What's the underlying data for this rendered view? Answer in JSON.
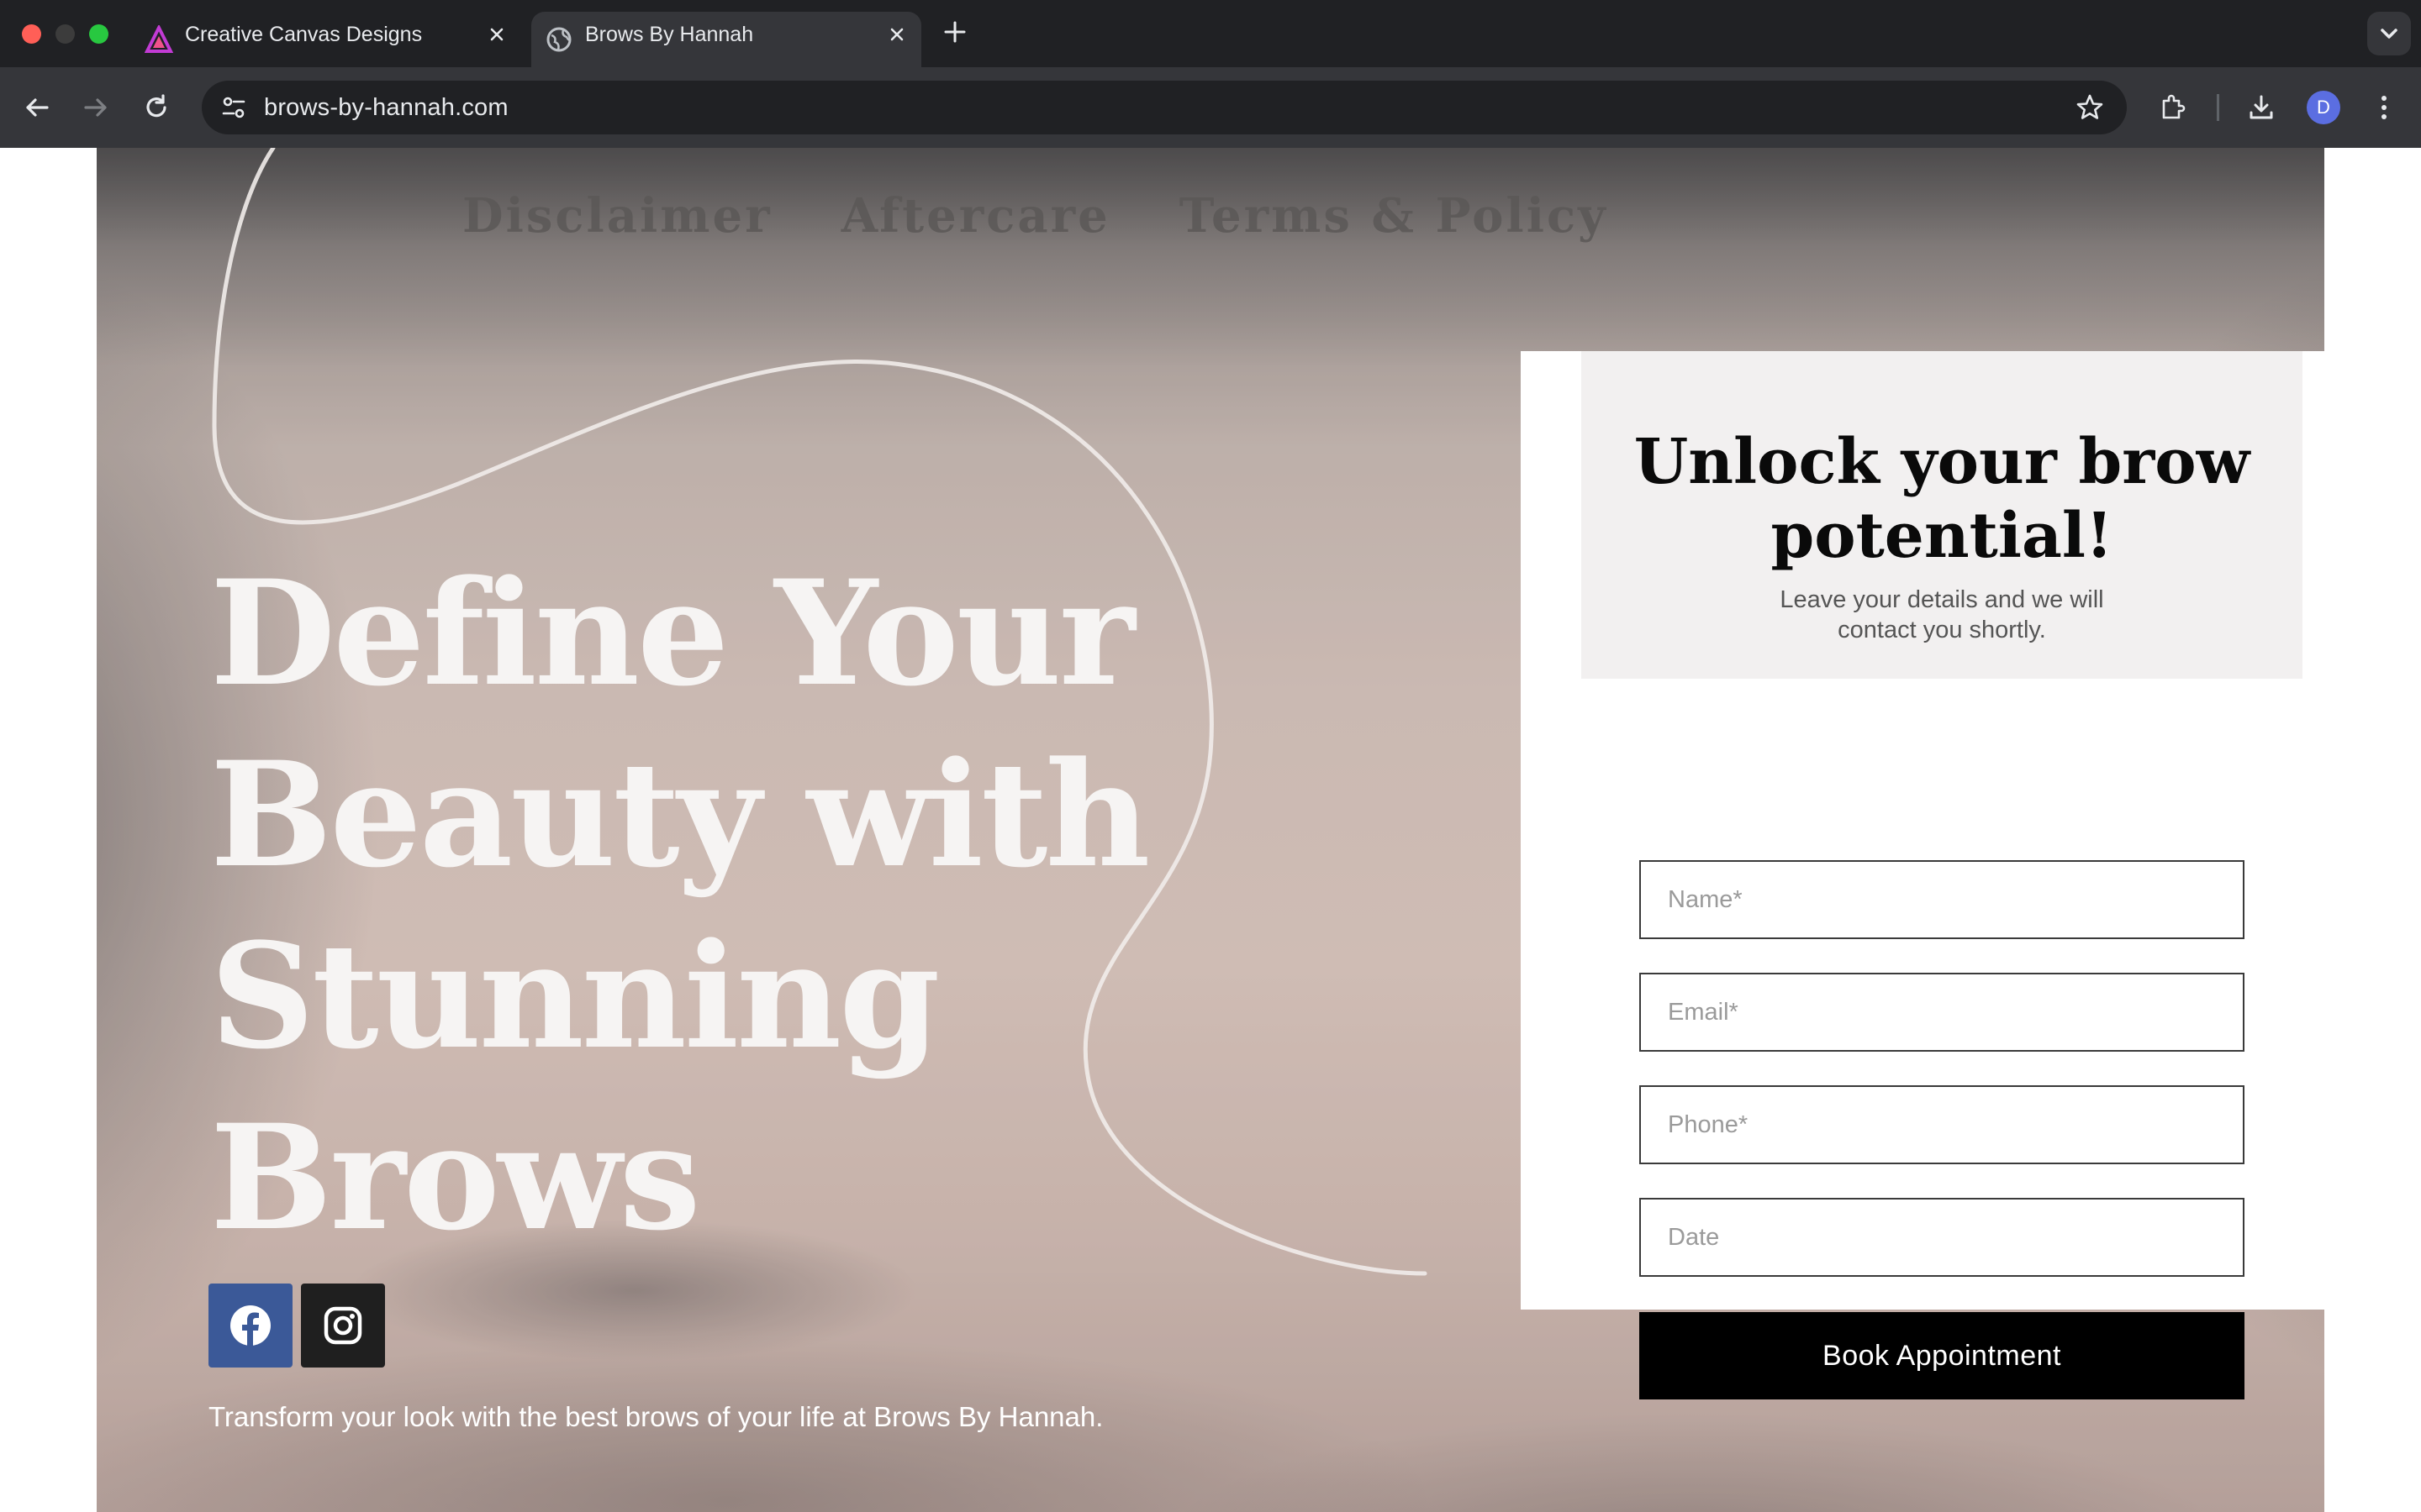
{
  "browser": {
    "tabs": [
      {
        "title": "Creative Canvas Designs",
        "active": false,
        "favicon": "creative-canvas-logo-icon"
      },
      {
        "title": "Brows By Hannah",
        "active": true,
        "favicon": "globe-icon"
      }
    ],
    "url": "brows-by-hannah.com",
    "profile_initial": "D"
  },
  "nav": {
    "items": [
      "Disclaimer",
      "Aftercare",
      "Terms & Policy"
    ]
  },
  "hero": {
    "headline": "Define Your Beauty with Stunning Brows",
    "tagline": "Transform your look with the best brows of your life at Brows By Hannah.",
    "social": [
      {
        "name": "facebook",
        "icon": "facebook-icon",
        "color": "#3b5998"
      },
      {
        "name": "instagram",
        "icon": "instagram-icon",
        "color": "#1f1f1f"
      }
    ]
  },
  "form": {
    "title": "Unlock your brow potential!",
    "subtitle": "Leave your details and we will contact you shortly.",
    "fields": {
      "name": {
        "placeholder": "Name*",
        "value": ""
      },
      "email": {
        "placeholder": "Email*",
        "value": ""
      },
      "phone": {
        "placeholder": "Phone*",
        "value": ""
      },
      "date": {
        "placeholder": "Date",
        "value": ""
      }
    },
    "submit_label": "Book Appointment"
  },
  "colors": {
    "chrome_dark": "#202124",
    "chrome_tab_active": "#35363a",
    "button_black": "#000000",
    "facebook_blue": "#3b5998",
    "card_header_bg": "#f2f0f0"
  }
}
